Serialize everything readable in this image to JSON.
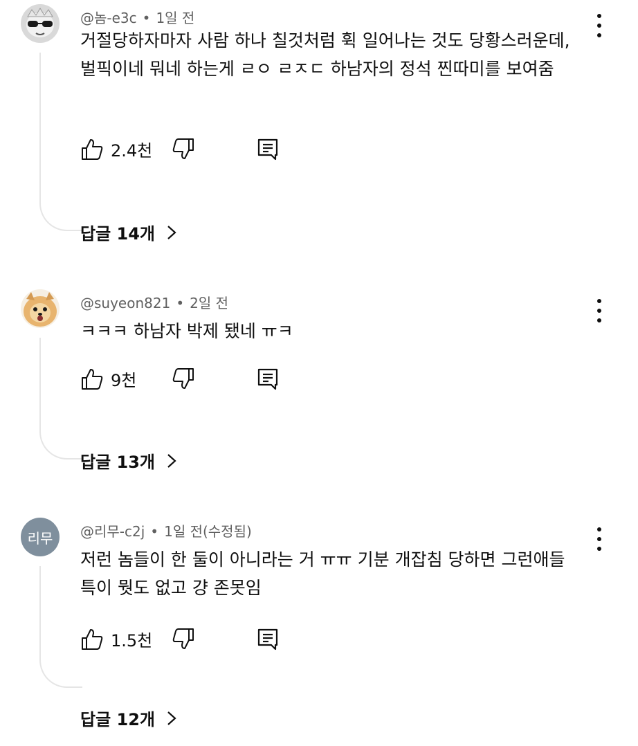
{
  "comments": [
    {
      "handle": "@놈-e3c",
      "dot": "•",
      "time": "1일 전",
      "avatar_icon": "sunglasses-character-avatar",
      "text": "거절당하자마자 사람 하나 칠것처럼 휙 일어나는 것도 당황스러운데, 벌픽이네 뭐네 하는게 ㄹㅇ ㄹㅈㄷ 하남자의 정석 찐따미를 보여줌",
      "likes": "2.4천",
      "replies": "답글 14개"
    },
    {
      "handle": "@suyeon821",
      "dot": "•",
      "time": "2일 전",
      "avatar_icon": "pomeranian-dog-avatar",
      "text": "ㅋㅋㅋ 하남자 박제 됐네 ㅠㅋ",
      "likes": "9천",
      "replies": "답글 13개"
    },
    {
      "handle": "@리무-c2j",
      "dot": "•",
      "time": "1일 전(수정됨)",
      "avatar_text": "리무",
      "text": "저런 놈들이 한 둘이 아니라는 거 ㅠㅠ 기분 개잡침 당하면 그런애들 특이 뭣도 없고 걍 존못임",
      "likes": "1.5천",
      "replies": "답글 12개"
    }
  ],
  "colors": {
    "text": "#0f0f0f",
    "meta": "#606060",
    "thread_line": "#e5e5e5",
    "initials_avatar": "#7f8f9d"
  }
}
